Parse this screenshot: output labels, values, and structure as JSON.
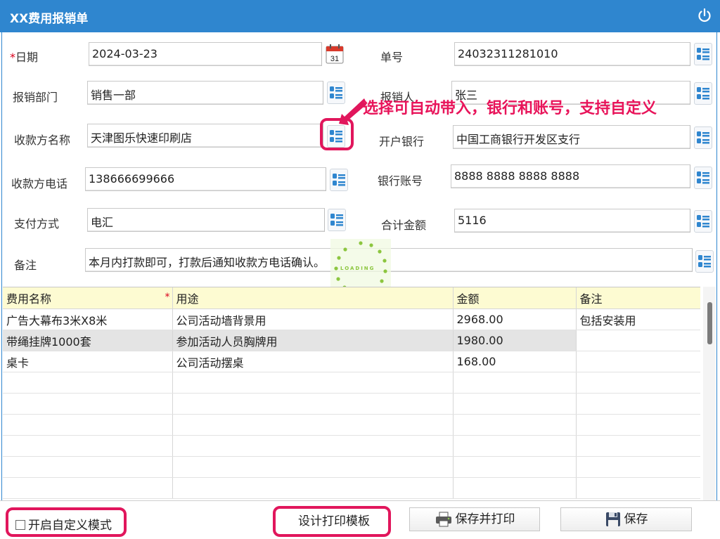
{
  "window": {
    "title": "XX费用报销单"
  },
  "form": {
    "date": {
      "label": "日期",
      "required_mark": "*",
      "value": "2024-03-23"
    },
    "number": {
      "label": "单号",
      "value": "24032311281010"
    },
    "department": {
      "label": "报销部门",
      "value": "销售一部"
    },
    "claimant": {
      "label": "报销人",
      "value": "张三"
    },
    "payee_name": {
      "label": "收款方名称",
      "value": "天津图乐快速印刷店"
    },
    "bank": {
      "label": "开户银行",
      "value": "中国工商银行开发区支行"
    },
    "payee_phone": {
      "label": "收款方电话",
      "value": "138666699666"
    },
    "account": {
      "label": "银行账号",
      "value": "8888 8888 8888 8888"
    },
    "pay_method": {
      "label": "支付方式",
      "value": "电汇"
    },
    "total": {
      "label": "合计金额",
      "value": "5116"
    },
    "remark": {
      "label": "备注",
      "value": "本月内打款即可，打款后通知收款方电话确认。"
    }
  },
  "annotation": {
    "text": "选择可自动带入，银行和账号，支持自定义",
    "color": "#e1165c"
  },
  "loading": {
    "text": "LOADING"
  },
  "grid": {
    "columns": [
      "费用名称",
      "用途",
      "金额",
      "备注"
    ],
    "required_mark": "*",
    "rows": [
      [
        "广告大幕布3米X8米",
        "公司活动墙背景用",
        "2968.00",
        "包括安装用"
      ],
      [
        "带绳挂牌1000套",
        "参加活动人员胸牌用",
        "1980.00",
        ""
      ],
      [
        "桌卡",
        "公司活动摆桌",
        "168.00",
        ""
      ],
      [
        "",
        "",
        "",
        ""
      ],
      [
        "",
        "",
        "",
        ""
      ],
      [
        "",
        "",
        "",
        ""
      ],
      [
        "",
        "",
        "",
        ""
      ],
      [
        "",
        "",
        "",
        ""
      ],
      [
        "",
        "",
        "",
        ""
      ]
    ]
  },
  "footer": {
    "custom_mode_label": "开启自定义模式",
    "design_label": "设计打印模板",
    "save_print_label": "保存并打印",
    "save_label": "保存"
  },
  "colors": {
    "titlebar": "#2f86cf",
    "header_row": "#fdfbd2",
    "selected_row": "#e4e4e4",
    "highlight": "#e1165c"
  },
  "icons": [
    "power-icon",
    "calendar-icon",
    "list-picker-icon",
    "printer-icon",
    "floppy-disk-icon"
  ]
}
